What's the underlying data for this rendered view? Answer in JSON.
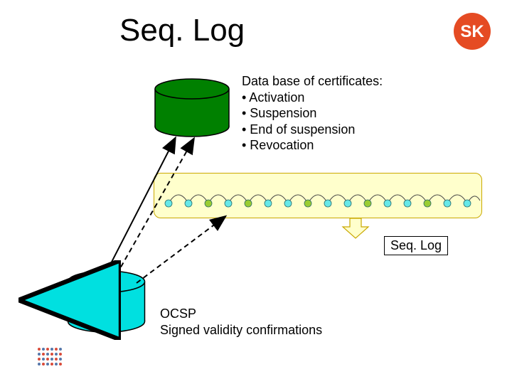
{
  "title": "Seq. Log",
  "badge": {
    "text": "SK",
    "color": "#e54b23"
  },
  "database_text": "Data base of certificates:\n• Activation\n• Suspension\n• End of suspension\n• Revocation",
  "seqlog_label": "Seq. Log",
  "ocsp_text": "OCSP\nSigned validity confirmations",
  "colors": {
    "db_top_fill": "#008000",
    "db_top_stroke": "#000000",
    "db_bottom_fill": "#00e0e0",
    "db_bottom_stroke": "#000000",
    "chain_bg": "#ffffcc",
    "chain_border": "#c9a800",
    "node_cyan": "#66e8e8",
    "node_olive": "#9acd32"
  },
  "chain": {
    "count": 16,
    "colors": [
      "cyan",
      "cyan",
      "olive",
      "cyan",
      "olive",
      "cyan",
      "cyan",
      "olive",
      "cyan",
      "cyan",
      "olive",
      "cyan",
      "cyan",
      "olive",
      "cyan",
      "cyan"
    ]
  }
}
